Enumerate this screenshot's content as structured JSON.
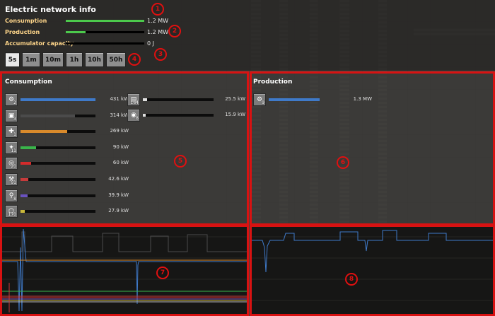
{
  "panel": {
    "title": "Electric network info",
    "stats": [
      {
        "label": "Consumption",
        "value": "1.2 MW",
        "fill": 1.0
      },
      {
        "label": "Production",
        "value": "1.2 MW",
        "fill": 0.25
      },
      {
        "label": "Accumulator capacity",
        "value": "0 J",
        "fill": 0.0
      }
    ],
    "time_tabs": [
      "5s",
      "1m",
      "10m",
      "1h",
      "10h",
      "50h"
    ],
    "active_tab": "5s"
  },
  "markers": [
    "1",
    "2",
    "3",
    "4",
    "5",
    "6",
    "7",
    "8"
  ],
  "consumption": {
    "title": "Consumption",
    "left_items": [
      {
        "icon": "inserter-icon",
        "glyph": "⚙",
        "count": "2",
        "value": "431 kW",
        "fill": 1.0,
        "color": "#3f7ac9"
      },
      {
        "icon": "assembler-icon",
        "glyph": "▣",
        "count": "3",
        "value": "314 kW",
        "fill": 0.73,
        "color": "#4b4b4b"
      },
      {
        "icon": "lab-icon",
        "glyph": "✚",
        "count": "1",
        "value": "269 kW",
        "fill": 0.62,
        "color": "#d98a2b"
      },
      {
        "icon": "small-lamp-icon",
        "glyph": "✦",
        "count": "11",
        "value": "90 kW",
        "fill": 0.21,
        "color": "#39b54a"
      },
      {
        "icon": "radar-icon",
        "glyph": "◎",
        "count": "20",
        "value": "60 kW",
        "fill": 0.14,
        "color": "#d42b2b"
      },
      {
        "icon": "electric-mining-drill-icon",
        "glyph": "⚒",
        "count": "91",
        "value": "42.6 kW",
        "fill": 0.1,
        "color": "#c63b3b"
      },
      {
        "icon": "pump-icon",
        "glyph": "⚲",
        "count": "8",
        "value": "39.9 kW",
        "fill": 0.09,
        "color": "#6a52c0"
      },
      {
        "icon": "roboport-icon",
        "glyph": "⬡",
        "count": "170",
        "value": "27.9 kW",
        "fill": 0.06,
        "color": "#c9b83a"
      }
    ],
    "right_items": [
      {
        "icon": "electric-furnace-icon",
        "glyph": "▤",
        "count": "164",
        "value": "25.5 kW",
        "fill": 0.06,
        "color": "#e0e0e0"
      },
      {
        "icon": "beacon-icon",
        "glyph": "◉",
        "count": "8",
        "value": "15.9 kW",
        "fill": 0.04,
        "color": "#e0e0e0"
      }
    ]
  },
  "production": {
    "title": "Production",
    "items": [
      {
        "icon": "steam-engine-icon",
        "glyph": "⚙",
        "count": "9",
        "value": "1.3 MW",
        "fill": 1.0,
        "color": "#3f7ac9"
      }
    ]
  },
  "colors": {
    "consumption_label": "#ffd68a",
    "red_annotation": "#d81212",
    "bar_green": "#4cc94c"
  }
}
